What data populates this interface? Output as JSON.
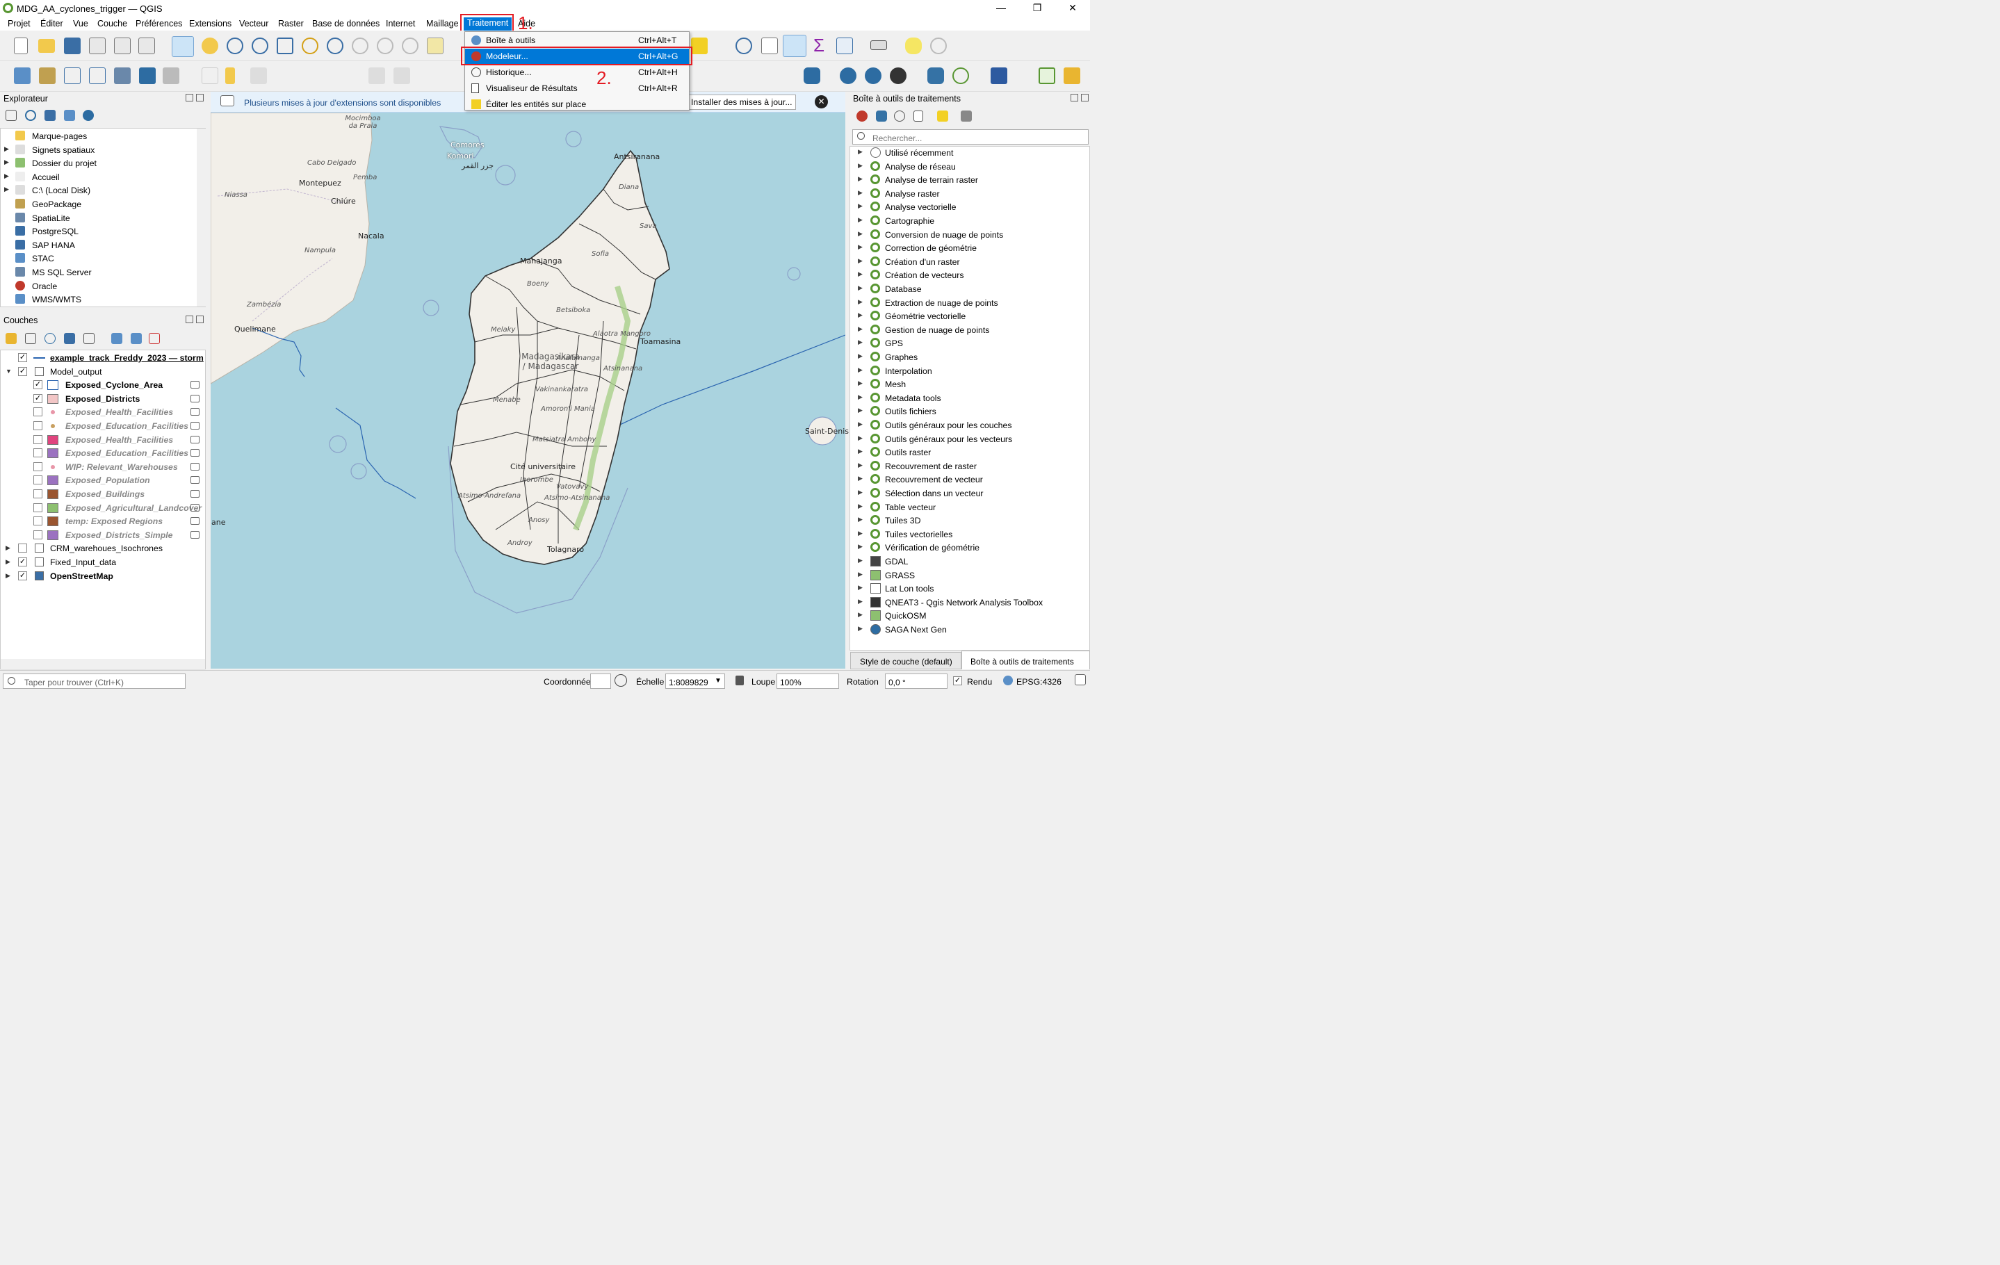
{
  "window": {
    "title": "MDG_AA_cyclones_trigger — QGIS",
    "min": "—",
    "max": "❐",
    "close": "✕"
  },
  "menubar": [
    "Projet",
    "Éditer",
    "Vue",
    "Couche",
    "Préférences",
    "Extensions",
    "Vecteur",
    "Raster",
    "Base de données",
    "Internet",
    "Maillage",
    "Traitement",
    "Aide"
  ],
  "annotations": {
    "step1": "1.",
    "step2": "2."
  },
  "dropdown": {
    "items": [
      {
        "label": "Boîte à outils",
        "shortcut": "Ctrl+Alt+T"
      },
      {
        "label": "Modeleur...",
        "shortcut": "Ctrl+Alt+G",
        "highlighted": true
      },
      {
        "label": "Historique...",
        "shortcut": "Ctrl+Alt+H"
      },
      {
        "label": "Visualiseur de Résultats",
        "shortcut": "Ctrl+Alt+R"
      },
      {
        "label": "Éditer les entités sur place",
        "shortcut": ""
      }
    ]
  },
  "explorer": {
    "title": "Explorateur",
    "items": [
      "Marque-pages",
      "Signets spatiaux",
      "Dossier du projet",
      "Accueil",
      "C:\\ (Local Disk)",
      "GeoPackage",
      "SpatiaLite",
      "PostgreSQL",
      "SAP HANA",
      "STAC",
      "MS SQL Server",
      "Oracle",
      "WMS/WMTS"
    ]
  },
  "layers": {
    "title": "Couches",
    "items": [
      {
        "label": "example_track_Freddy_2023 — storm",
        "style": "bold underline",
        "checked": true
      },
      {
        "label": "Model_output",
        "checked": true
      },
      {
        "label": "Exposed_Cyclone_Area",
        "checked": true,
        "swatch": "#ffffff"
      },
      {
        "label": "Exposed_Districts",
        "checked": true,
        "swatch": "#f2c6c6"
      },
      {
        "label": "Exposed_Health_Facilities",
        "checked": false,
        "swatch": "#e896a8"
      },
      {
        "label": "Exposed_Education_Facilities",
        "checked": false,
        "swatch": "#c8a060"
      },
      {
        "label": "Exposed_Health_Facilities",
        "checked": false,
        "swatch": "#e0447e"
      },
      {
        "label": "Exposed_Education_Facilities",
        "checked": false,
        "swatch": "#9b72c0"
      },
      {
        "label": "WIP: Relevant_Warehouses",
        "checked": false,
        "swatch": "#e896a8"
      },
      {
        "label": "Exposed_Population",
        "checked": false,
        "swatch": "#9b72c0"
      },
      {
        "label": "Exposed_Buildings",
        "checked": false,
        "swatch": "#9a5530"
      },
      {
        "label": "Exposed_Agricultural_Landcover",
        "checked": false,
        "swatch": "#8dc070"
      },
      {
        "label": "temp: Exposed Regions",
        "checked": false,
        "swatch": "#9a5530"
      },
      {
        "label": "Exposed_Districts_Simple",
        "checked": false,
        "swatch": "#9b72c0"
      },
      {
        "label": "CRM_warehoues_Isochrones",
        "checked": false
      },
      {
        "label": "Fixed_Input_data",
        "checked": true
      },
      {
        "label": "OpenStreetMap",
        "checked": true
      }
    ]
  },
  "notification": {
    "text": "Plusieurs mises à jour d'extensions sont disponibles",
    "button": "Installer des mises à jour..."
  },
  "toolbox": {
    "title": "Boîte à outils de traitements",
    "search_placeholder": "Rechercher...",
    "items": [
      "Utilisé récemment",
      "Analyse de réseau",
      "Analyse de terrain raster",
      "Analyse raster",
      "Analyse vectorielle",
      "Cartographie",
      "Conversion de nuage de points",
      "Correction de géométrie",
      "Création d'un raster",
      "Création de vecteurs",
      "Database",
      "Extraction de nuage de points",
      "Géométrie vectorielle",
      "Gestion de nuage de points",
      "GPS",
      "Graphes",
      "Interpolation",
      "Mesh",
      "Metadata tools",
      "Outils fichiers",
      "Outils généraux pour les couches",
      "Outils généraux pour les vecteurs",
      "Outils raster",
      "Recouvrement de raster",
      "Recouvrement de vecteur",
      "Sélection dans un vecteur",
      "Table vecteur",
      "Tuiles 3D",
      "Tuiles vectorielles",
      "Vérification de géométrie",
      "GDAL",
      "GRASS",
      "Lat Lon tools",
      "QNEAT3 - Qgis Network Analysis Toolbox",
      "QuickOSM",
      "SAGA Next Gen"
    ],
    "tabs": [
      "Style de couche (default)",
      "Boîte à outils de traitements"
    ]
  },
  "map_labels": [
    "Mocimboa da Praia",
    "Comores",
    "Komori",
    "جزر القمر",
    "Cabo Delgado",
    "Pemba",
    "Montepuez",
    "Chiúre",
    "Niassa",
    "Nacala",
    "Nampula",
    "Zambézia",
    "Quelimane",
    "Antsiranana",
    "Diana",
    "Sava",
    "Mahajanga",
    "Sofia",
    "Boeny",
    "Betsiboka",
    "Melaky",
    "Alaotra Mangoro",
    "Toamasina",
    "Madagasikara / Madagascar",
    "Analamanga",
    "Vakinankaratra",
    "Menabe",
    "Amoron'i Mania",
    "Atsinanana",
    "Matsiatra Ambony",
    "Cité universitaire",
    "Ihorombe",
    "Atsimo-Andrefana",
    "Vatovavy",
    "Atsimo-Atsinanana",
    "Anosy",
    "Androy",
    "Tolagnaro",
    "Saint-Denis",
    "ane"
  ],
  "status": {
    "locator_placeholder": "Taper pour trouver (Ctrl+K)",
    "coord_label": "Coordonnée",
    "scale_label": "Échelle",
    "scale_value": "1:8089829",
    "zoom_label": "Loupe",
    "zoom_value": "100%",
    "rotation_label": "Rotation",
    "rotation_value": "0,0 °",
    "render_label": "Rendu",
    "crs": "EPSG:4326"
  },
  "colors": {
    "accent": "#0078d7",
    "annotation": "#e41b23",
    "sea": "#aad3df",
    "land": "#f2efe9"
  }
}
